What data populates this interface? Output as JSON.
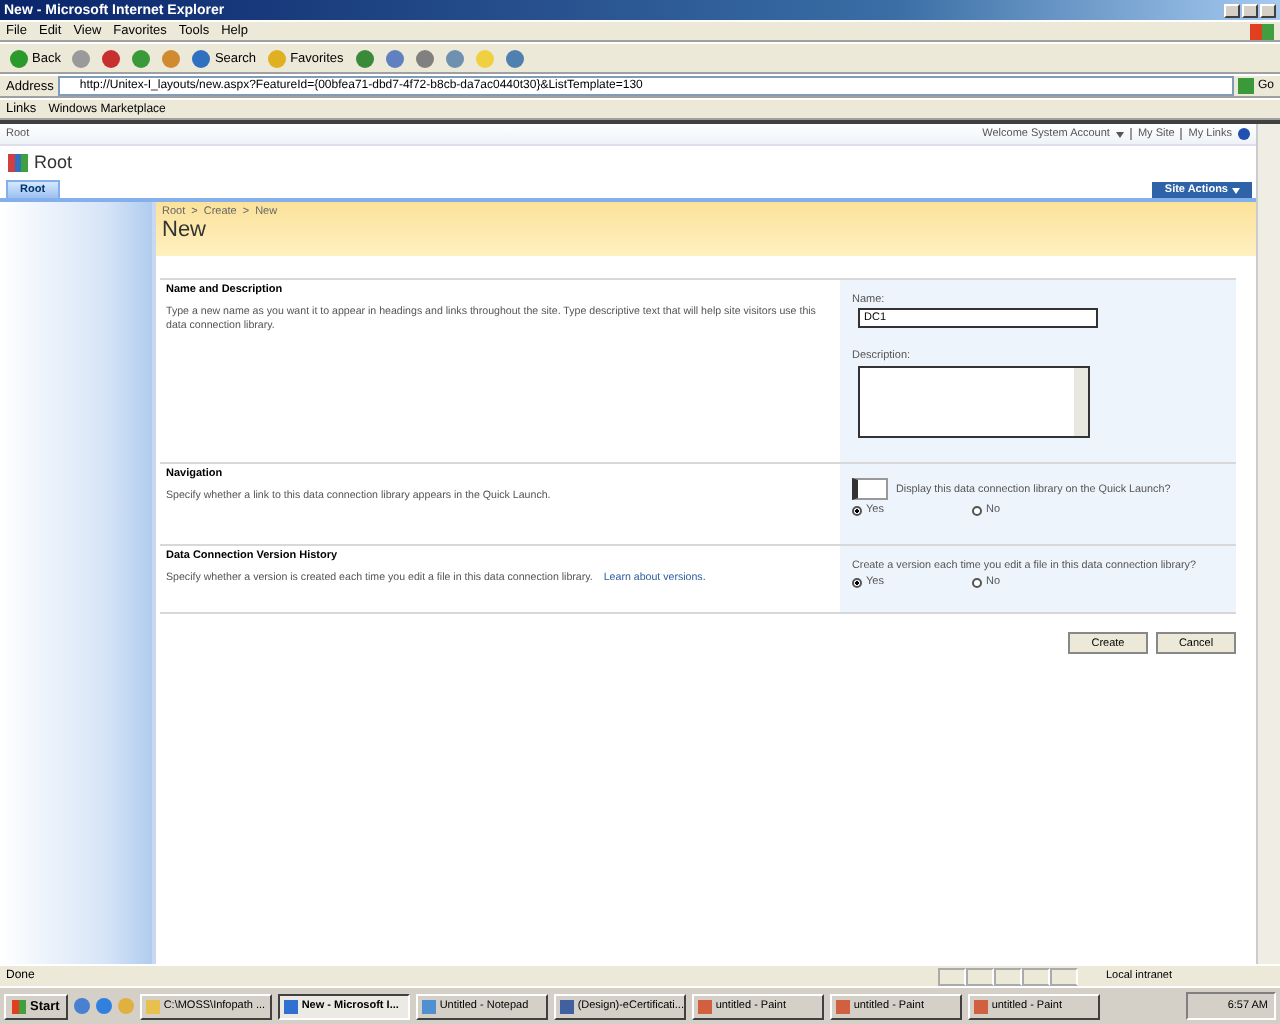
{
  "window": {
    "title": "New - Microsoft Internet Explorer"
  },
  "menu": [
    "File",
    "Edit",
    "View",
    "Favorites",
    "Tools",
    "Help"
  ],
  "toolbar": [
    {
      "kind": "back",
      "label": "Back"
    },
    {
      "kind": "forward"
    },
    {
      "kind": "stop"
    },
    {
      "kind": "refresh"
    },
    {
      "kind": "home"
    },
    {
      "kind": "search",
      "label": "Search"
    },
    {
      "kind": "favorites",
      "label": "Favorites"
    },
    {
      "kind": "history"
    },
    {
      "kind": "mail"
    },
    {
      "kind": "print"
    },
    {
      "kind": "edit"
    },
    {
      "kind": "note"
    },
    {
      "kind": "messenger"
    }
  ],
  "address": {
    "label": "Address",
    "value": "http://Unitex-I_layouts/new.aspx?FeatureId={00bfea71-dbd7-4f72-b8cb-da7ac0440t30}&ListTemplate=130",
    "go": "Go"
  },
  "links": {
    "label": "Links",
    "items": [
      "Windows Marketplace"
    ]
  },
  "site": {
    "top_link": "Root",
    "welcome": "Welcome System Account",
    "nav_links": [
      "My Site",
      "My Links"
    ],
    "title": "Root",
    "tabs": [
      {
        "label": "Root",
        "selected": true
      }
    ],
    "site_actions": "Site Actions"
  },
  "page": {
    "breadcrumb": [
      "Root",
      "Create",
      "New"
    ],
    "breadcrumb_separator": ">",
    "title": "New"
  },
  "sections": [
    {
      "kind": "name",
      "heading": "Name and Description",
      "description": "Type a new name as you want it to appear in headings and links throughout the site. Type descriptive text that will help site visitors use this data connection library.",
      "name_label": "Name:",
      "name_value": "DC1",
      "description_label": "Description:"
    },
    {
      "kind": "choice",
      "heading": "Navigation",
      "description": "Specify whether a link to this data connection library appears in the Quick Launch.",
      "question": "Display this data connection library on the Quick Launch?",
      "icon": true,
      "options": [
        {
          "label": "Yes",
          "selected": true
        },
        {
          "label": "No",
          "selected": false
        }
      ]
    },
    {
      "kind": "choice",
      "heading": "Data Connection Version History",
      "description": "Specify whether a version is created each time you edit a file in this data connection library.",
      "link": "Learn about versions.",
      "question": "Create a version each time you edit a file in this data connection library?",
      "icon": false,
      "options": [
        {
          "label": "Yes",
          "selected": true
        },
        {
          "label": "No",
          "selected": false
        }
      ]
    }
  ],
  "buttons": [
    "Create",
    "Cancel"
  ],
  "status_bar": {
    "text": "Done",
    "zone": "Local intranet"
  },
  "taskbar": {
    "start": "Start",
    "tasks": [
      {
        "label": "C:\\MOSS\\Infopath ...",
        "kind": "folder",
        "selected": false
      },
      {
        "label": "New - Microsoft I...",
        "kind": "ie",
        "selected": true
      },
      {
        "label": "Untitled - Notepad",
        "kind": "notepad",
        "selected": false
      },
      {
        "label": "(Design)-eCertificati...",
        "kind": "app",
        "selected": false
      },
      {
        "label": "untitled - Paint",
        "kind": "paint",
        "selected": false
      },
      {
        "label": "untitled - Paint",
        "kind": "paint",
        "selected": false
      },
      {
        "label": "untitled - Paint",
        "kind": "paint",
        "selected": false
      }
    ],
    "clock": "6:57 AM"
  }
}
